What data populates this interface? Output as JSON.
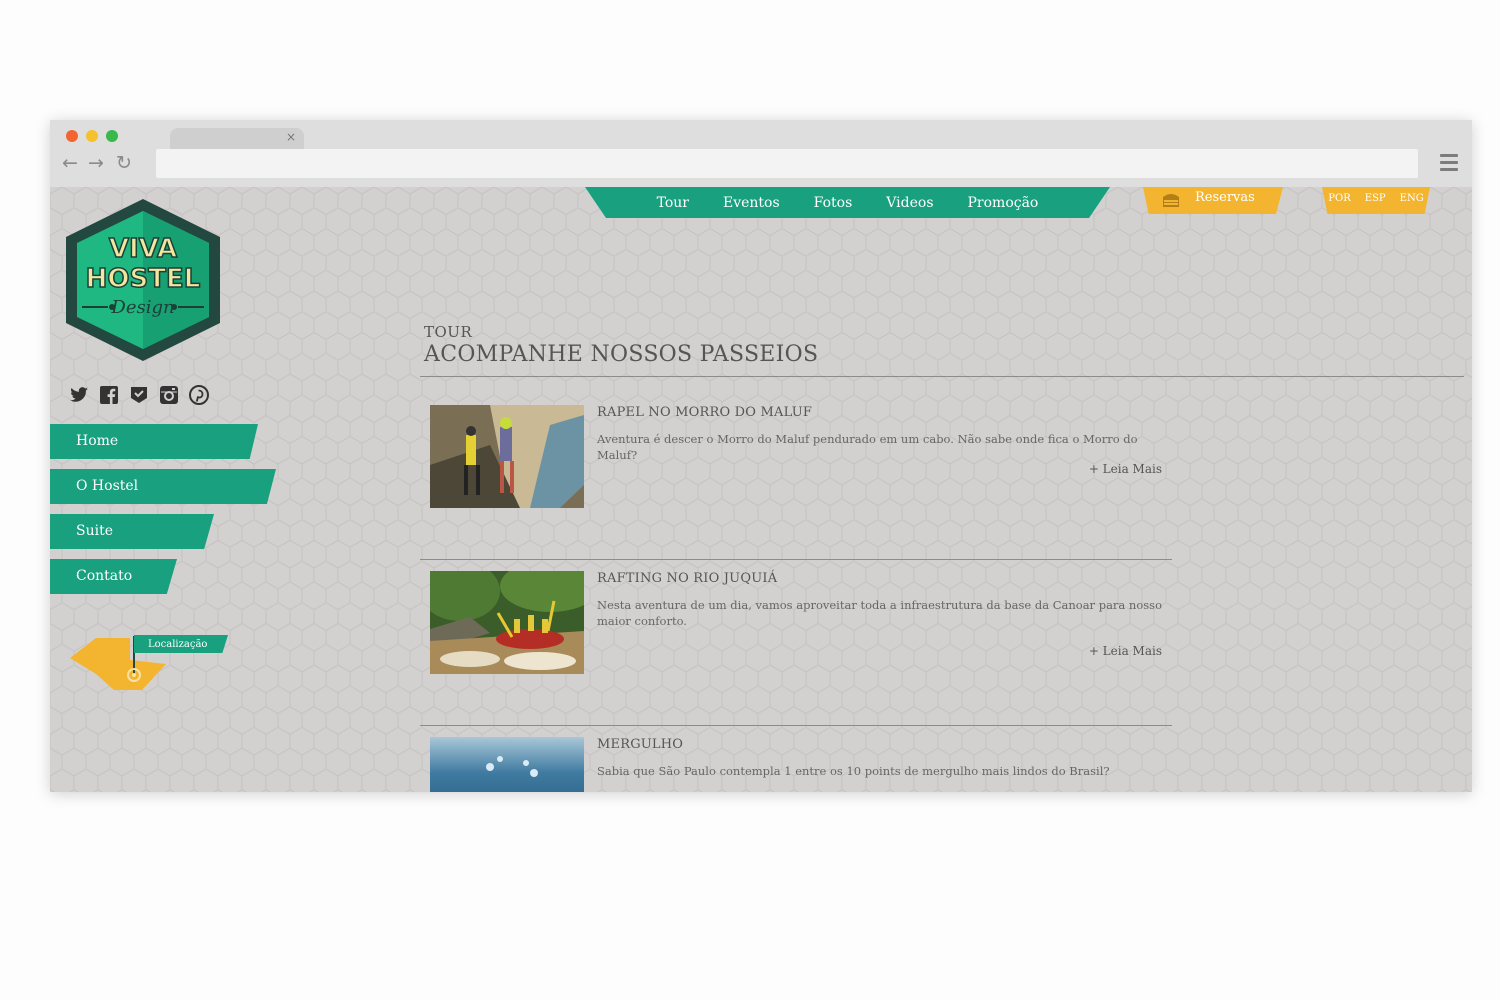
{
  "browser": {
    "tab_close_glyph": "×",
    "url": ""
  },
  "topnav": {
    "items": [
      "Tour",
      "Eventos",
      "Fotos",
      "Videos",
      "Promoção"
    ]
  },
  "reservas": {
    "label": "Reservas"
  },
  "languages": [
    "POR",
    "ESP",
    "ENG"
  ],
  "logo": {
    "line1": "VIVA",
    "line2": "HOSTEL",
    "line3": "Design"
  },
  "social": [
    "twitter-icon",
    "facebook-icon",
    "foursquare-icon",
    "instagram-icon",
    "pinterest-icon"
  ],
  "sidebar": {
    "items": [
      {
        "label": "Home"
      },
      {
        "label": "O Hostel"
      },
      {
        "label": "Suite"
      },
      {
        "label": "Contato"
      }
    ],
    "location_label": "Localização"
  },
  "section": {
    "kicker": "TOUR",
    "title": "ACOMPANHE NOSSOS PASSEIOS"
  },
  "tours": [
    {
      "title": "RAPEL NO MORRO DO MALUF",
      "description": "Aventura é descer o Morro do Maluf pendurado em um cabo. Não sabe onde fica o Morro do Maluf?",
      "more": "+ Leia Mais"
    },
    {
      "title": "RAFTING NO RIO JUQUIÁ",
      "description": "Nesta aventura de um dia, vamos aproveitar toda a infraestrutura da base da Canoar para nosso maior conforto.",
      "more": "+ Leia Mais"
    },
    {
      "title": "MERGULHO",
      "description": "Sabia que São Paulo contempla 1 entre os 10 points de mergulho mais lindos do Brasil?",
      "more": ""
    }
  ],
  "colors": {
    "brand_green": "#19a07f",
    "accent_yellow": "#f3b52f",
    "page_bg": "#d3d0d0"
  }
}
